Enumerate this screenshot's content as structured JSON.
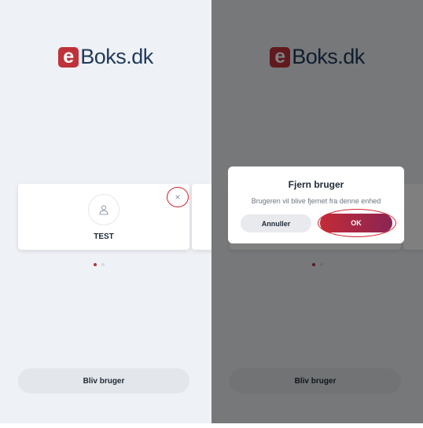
{
  "colors": {
    "brand_red": "#c0323a",
    "logo_blue": "#1f3a5a",
    "annotation_red": "#d0202a"
  },
  "left_screen": {
    "logo": {
      "mark": "e",
      "text": "Boks.dk"
    },
    "user_card": {
      "icon": "user-icon",
      "name": "TEST"
    },
    "remove_button": {
      "icon": "close-icon",
      "label": "×"
    },
    "pagination": {
      "count": 2,
      "active": 1
    },
    "signup_button_label": "Bliv bruger"
  },
  "right_screen": {
    "logo": {
      "mark": "e",
      "text": "Boks.dk"
    },
    "dialog": {
      "title": "Fjern bruger",
      "message": "Brugeren vil blive fjernet fra denne enhed",
      "cancel_label": "Annuller",
      "ok_label": "OK"
    },
    "pagination": {
      "count": 2,
      "active": 1
    },
    "signup_button_label": "Bliv bruger"
  }
}
